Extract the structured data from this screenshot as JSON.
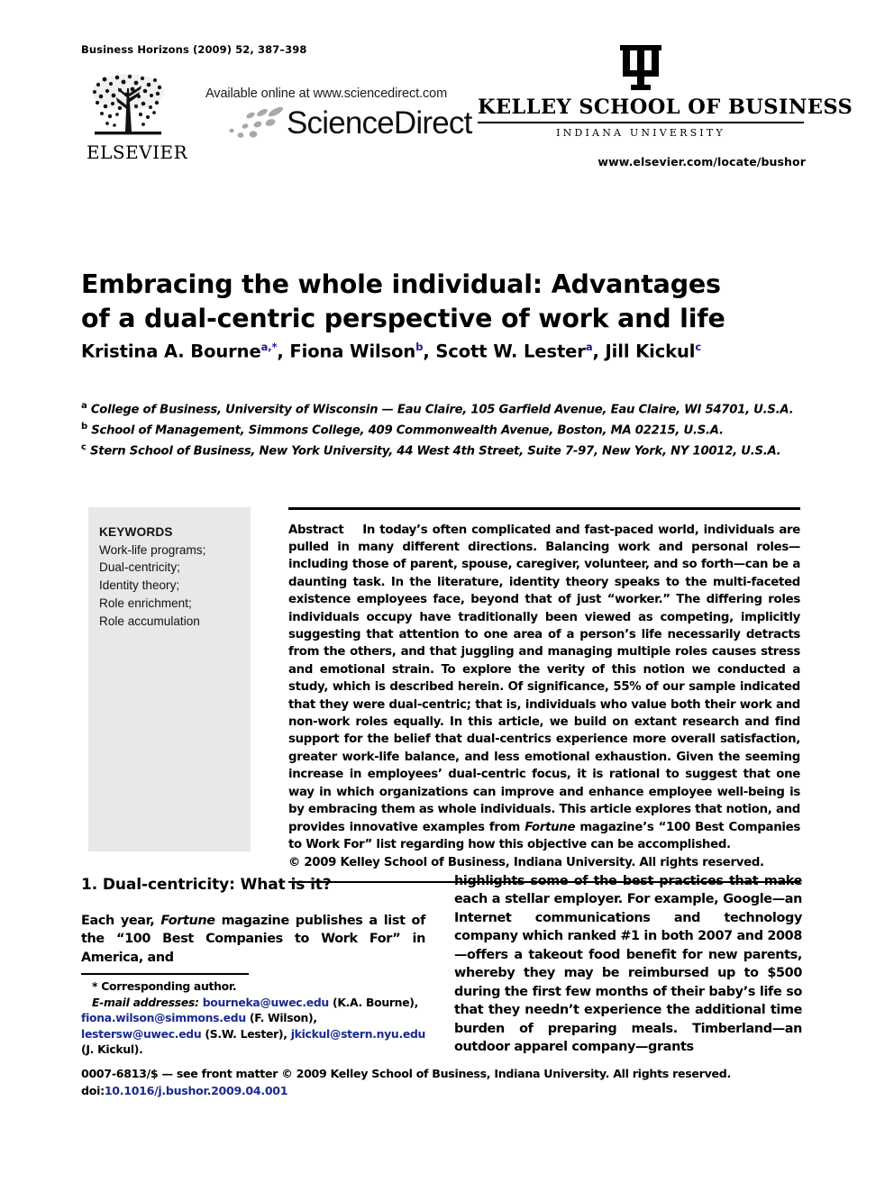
{
  "masthead": {
    "journal_reference": "Business Horizons (2009) 52, 387–398",
    "elsevier_wordmark": "ELSEVIER",
    "sciencedirect_available": "Available online at www.sciencedirect.com",
    "sciencedirect_wordmark": "ScienceDirect",
    "kelley_name": "KELLEY SCHOOL OF BUSINESS",
    "kelley_subtitle": "INDIANA UNIVERSITY",
    "elsevier_locator_url": "www.elsevier.com/locate/bushor"
  },
  "article": {
    "title_line1": "Embracing the whole individual: Advantages",
    "title_line2": "of a dual-centric perspective of work and life",
    "authors": [
      {
        "name": "Kristina A. Bourne",
        "markers": "a,*"
      },
      {
        "name": "Fiona Wilson",
        "markers": "b"
      },
      {
        "name": "Scott W. Lester",
        "markers": "a"
      },
      {
        "name": "Jill Kickul",
        "markers": "c"
      }
    ],
    "affiliations": [
      {
        "marker": "a",
        "text": "College of Business, University of Wisconsin — Eau Claire, 105 Garfield Avenue, Eau Claire, WI 54701, U.S.A."
      },
      {
        "marker": "b",
        "text": "School of Management, Simmons College, 409 Commonwealth Avenue, Boston, MA 02215, U.S.A."
      },
      {
        "marker": "c",
        "text": "Stern School of Business, New York University, 44 West 4th Street, Suite 7-97, New York, NY 10012, U.S.A."
      }
    ]
  },
  "keywords": {
    "heading": "KEYWORDS",
    "items": [
      "Work-life programs;",
      "Dual-centricity;",
      "Identity theory;",
      "Role enrichment;",
      "Role accumulation"
    ]
  },
  "abstract": {
    "label": "Abstract",
    "text": "In today’s often complicated and fast-paced world, individuals are pulled in many different directions. Balancing work and personal roles—including those of parent, spouse, caregiver, volunteer, and so forth—can be a daunting task. In the literature, identity theory speaks to the multi-faceted existence employees face, beyond that of just “worker.” The differing roles individuals occupy have traditionally been viewed as competing, implicitly suggesting that attention to one area of a person’s life necessarily detracts from the others, and that juggling and managing multiple roles causes stress and emotional strain. To explore the verity of this notion we conducted a study, which is described herein. Of significance, 55% of our sample indicated that they were dual-centric; that is, individuals who value both their work and non-work roles equally. In this article, we build on extant research and find support for the belief that dual-centrics experience more overall satisfaction, greater work-life balance, and less emotional exhaustion. Given the seeming increase in employees’ dual-centric focus, it is rational to suggest that one way in which organizations can improve and enhance employee well-being is by embracing them as whole individuals. This article explores that notion, and provides innovative examples from ",
    "italic_term": "Fortune",
    "text_after_italic": " magazine’s “100 Best Companies to Work For” list regarding how this objective can be accomplished.",
    "copyright": "© 2009 Kelley School of Business, Indiana University. All rights reserved."
  },
  "section": {
    "heading": "1. Dual-centricity: What is it?",
    "left_column_before_italic": "Each year, ",
    "left_column_italic": "Fortune",
    "left_column_after_italic": " magazine publishes a list of the “100 Best Companies to Work For” in America, and",
    "right_column": "highlights some of the best practices that make each a stellar employer. For example, Google—an Internet communications and technology company which ranked #1 in both 2007 and 2008—offers a takeout food benefit for new parents, whereby they may be reimbursed up to $500 during the first few months of their baby’s life so that they needn’t experience the additional time burden of preparing meals. Timberland—an outdoor apparel company—grants"
  },
  "footnotes": {
    "corresponding": "* Corresponding author.",
    "email_label": "E-mail addresses:",
    "emails": [
      {
        "address": "bourneka@uwec.edu",
        "person": "(K.A. Bourne),"
      },
      {
        "address": "fiona.wilson@simmons.edu",
        "person": "(F. Wilson),"
      },
      {
        "address": "lestersw@uwec.edu",
        "person": "(S.W. Lester),"
      },
      {
        "address": "jkickul@stern.nyu.edu",
        "person": "(J. Kickul)."
      }
    ]
  },
  "imprint": {
    "front_matter": "0007-6813/$ — see front matter © 2009 Kelley School of Business, Indiana University. All rights reserved.",
    "doi_label": "doi:",
    "doi_value": "10.1016/j.bushor.2009.04.001"
  },
  "colors": {
    "link_blue": "#1b2a8f",
    "keyword_box_gray": "#e8e8e8",
    "rule_black": "#000000"
  }
}
